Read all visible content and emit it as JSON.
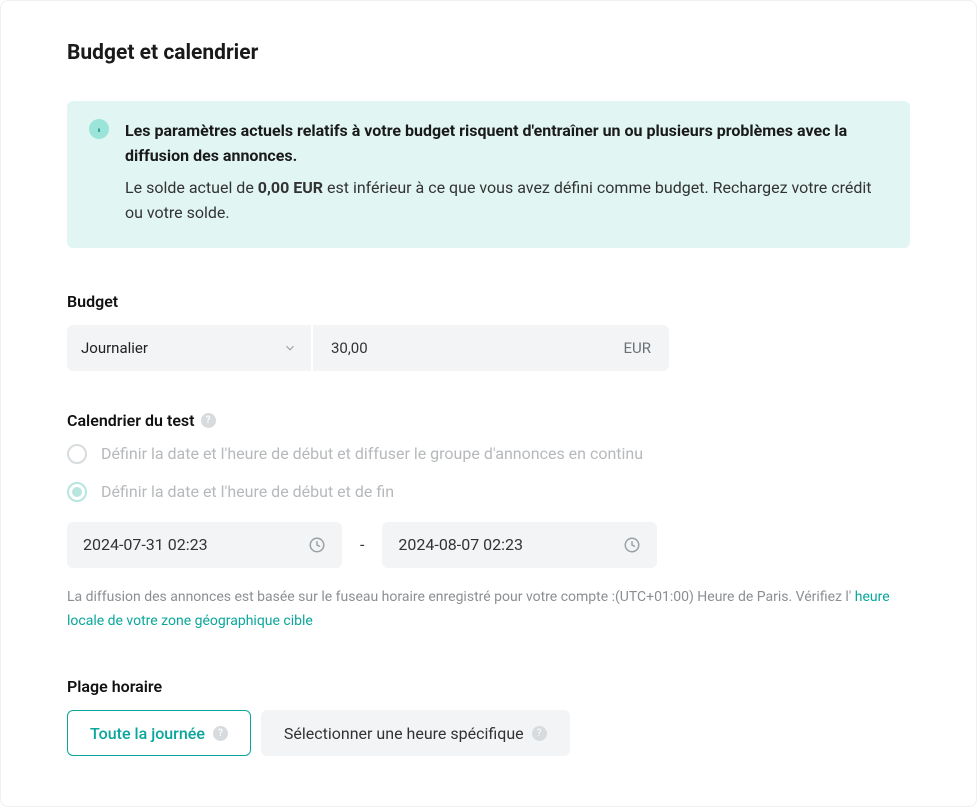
{
  "header": {
    "title": "Budget et calendrier"
  },
  "alert": {
    "headline": "Les paramètres actuels relatifs à votre budget risquent d'entraîner un ou plusieurs problèmes avec la diffusion des annonces.",
    "body_before": "Le solde actuel de ",
    "amount": "0,00  EUR",
    "body_after": " est inférieur à ce que vous avez défini comme budget. Rechargez votre crédit ou votre solde."
  },
  "budget": {
    "label": "Budget",
    "frequency_selected": "Journalier",
    "amount_value": "30,00",
    "currency": "EUR"
  },
  "schedule": {
    "label": "Calendrier du test",
    "option_continuous": "Définir la date et l'heure de début et diffuser le groupe d'annonces en continu",
    "option_range": "Définir la date et l'heure de début et de fin",
    "start_value": "2024-07-31 02:23",
    "end_value": "2024-08-07 02:23",
    "separator": "-",
    "note_prefix": "La diffusion des annonces est basée sur le fuseau horaire enregistré pour votre compte :(UTC+01:00) Heure de Paris. Vérifiez l' ",
    "note_link": "heure locale de votre zone géographique cible"
  },
  "dayparting": {
    "label": "Plage horaire",
    "option_all_day": "Toute la journée",
    "option_specific": "Sélectionner une heure spécifique"
  }
}
